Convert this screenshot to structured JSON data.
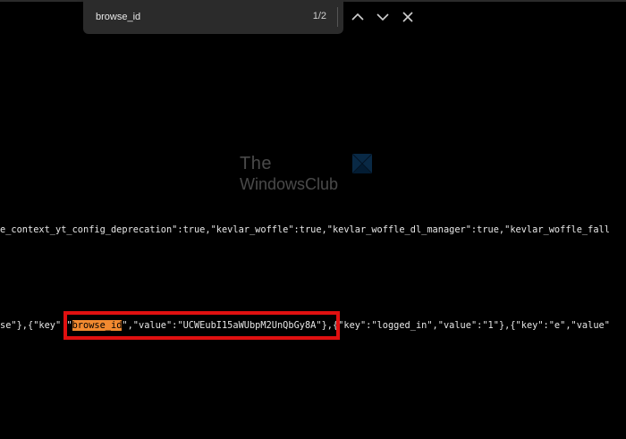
{
  "find_bar": {
    "query": "browse_id",
    "match_count": "1/2",
    "prev_icon": "chevron-up-icon",
    "next_icon": "chevron-down-icon",
    "close_icon": "close-icon"
  },
  "watermark": {
    "line1": "The",
    "line2": "WindowsClub"
  },
  "content": {
    "line1": "e_context_yt_config_deprecation\":true,\"kevlar_woffle\":true,\"kevlar_woffle_dl_manager\":true,\"kevlar_woffle_fall",
    "line2_prefix": "se\"},{\"key\" \"",
    "line2_highlight": "browse_id",
    "line2_after": "\",\"value\":\"UCWEubI15aWUbpM2UnQbGy8A\"}",
    "line2_suffix": ",{\"key\":\"logged_in\",\"value\":\"1\"},{\"key\":\"e\",\"value\""
  },
  "colors": {
    "background": "#000000",
    "find_bar": "#2b2b2b",
    "highlight": "#f28a30",
    "callout_box": "#e01010"
  }
}
